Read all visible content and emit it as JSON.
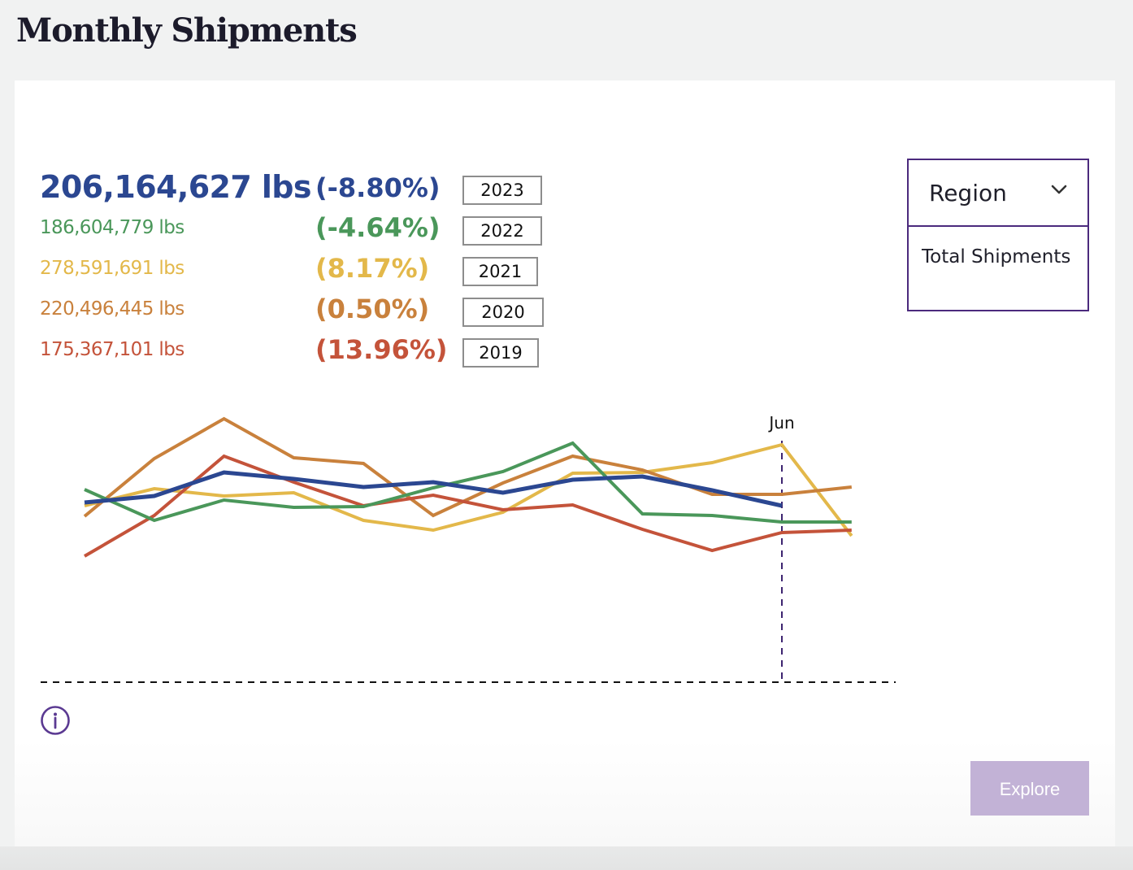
{
  "page": {
    "title": "Monthly Shipments"
  },
  "stats": [
    {
      "year": "2023",
      "value": "206,164,627 lbs",
      "change": "(-8.80%)",
      "color": "#2b4791",
      "primary": true
    },
    {
      "year": "2022",
      "value": "186,604,779 lbs",
      "change": "(-4.64%)",
      "color": "#4a975a",
      "primary": false
    },
    {
      "year": "2021",
      "value": "278,591,691 lbs",
      "change": "(8.17%)",
      "color": "#e3b84a",
      "primary": false
    },
    {
      "year": "2020",
      "value": "220,496,445 lbs",
      "change": "(0.50%)",
      "color": "#c9813c",
      "primary": false
    },
    {
      "year": "2019",
      "value": "175,367,101 lbs",
      "change": "(13.96%)",
      "color": "#c4533a",
      "primary": false
    }
  ],
  "region_select": {
    "label": "Region",
    "selected_option": "Total Shipments",
    "border_color": "#4b2a7d"
  },
  "explore_button": {
    "label": "Explore",
    "color": "#c2b2d6"
  },
  "info_icon": {
    "name": "info-icon",
    "color": "#5b3a92"
  },
  "chart_data": {
    "type": "line",
    "title": "",
    "xlabel": "",
    "ylabel": "",
    "grid": false,
    "y_axis_shown": false,
    "note": "No y-axis scale shown; values are relative heights above the dashed baseline (0).",
    "ylim": [
      0,
      400
    ],
    "x_count": 12,
    "x_labels_visible": {
      "10": "Jun"
    },
    "highlight_index": 10,
    "highlight_label": "Jun",
    "baseline": 0,
    "series": [
      {
        "name": "2023",
        "color": "#2b4791",
        "values": [
          221,
          229,
          258,
          250,
          240,
          246,
          233,
          249,
          253,
          236,
          217
        ]
      },
      {
        "name": "2022",
        "color": "#4a975a",
        "values": [
          237,
          199,
          224,
          215,
          216,
          239,
          259,
          294,
          207,
          205,
          197,
          197
        ]
      },
      {
        "name": "2021",
        "color": "#e3b84a",
        "values": [
          217,
          238,
          229,
          233,
          199,
          187,
          209,
          257,
          258,
          270,
          292,
          180
        ]
      },
      {
        "name": "2020",
        "color": "#c9813c",
        "values": [
          204,
          275,
          324,
          276,
          269,
          205,
          245,
          278,
          261,
          231,
          231,
          240
        ]
      },
      {
        "name": "2019",
        "color": "#c4533a",
        "values": [
          155,
          205,
          278,
          246,
          217,
          230,
          212,
          218,
          188,
          162,
          184,
          187
        ]
      }
    ],
    "line_order_back_to_front": [
      "2021",
      "2020",
      "2019",
      "2022",
      "2023"
    ]
  }
}
